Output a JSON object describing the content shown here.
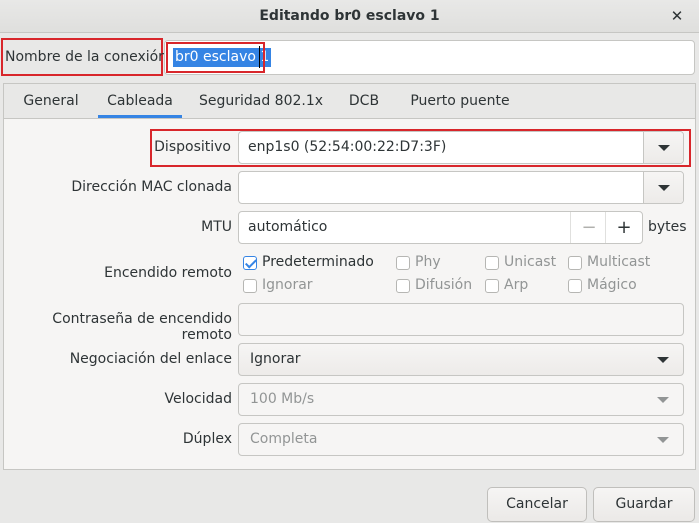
{
  "window": {
    "title": "Editando br0 esclavo 1",
    "close_glyph": "✕"
  },
  "connection": {
    "label": "Nombre de la conexión",
    "value": "br0 esclavo 1"
  },
  "tabs": [
    {
      "label": "General"
    },
    {
      "label": "Cableada"
    },
    {
      "label": "Seguridad 802.1x"
    },
    {
      "label": "DCB"
    },
    {
      "label": "Puerto puente"
    }
  ],
  "active_tab": "Cableada",
  "form": {
    "device": {
      "label": "Dispositivo",
      "value": "enp1s0 (52:54:00:22:D7:3F)"
    },
    "cloned_mac": {
      "label": "Dirección MAC clonada",
      "value": ""
    },
    "mtu": {
      "label": "MTU",
      "value": "automático",
      "minus": "−",
      "plus": "+",
      "unit": "bytes"
    },
    "wake_on_lan": {
      "label": "Encendido remoto",
      "options": [
        {
          "label": "Predeterminado",
          "checked": true,
          "enabled": true
        },
        {
          "label": "Phy",
          "checked": false,
          "enabled": false
        },
        {
          "label": "Unicast",
          "checked": false,
          "enabled": false
        },
        {
          "label": "Multicast",
          "checked": false,
          "enabled": false
        },
        {
          "label": "Ignorar",
          "checked": false,
          "enabled": false
        },
        {
          "label": "Difusión",
          "checked": false,
          "enabled": false
        },
        {
          "label": "Arp",
          "checked": false,
          "enabled": false
        },
        {
          "label": "Mágico",
          "checked": false,
          "enabled": false
        }
      ]
    },
    "wol_password": {
      "label": "Contraseña de encendido remoto",
      "value": ""
    },
    "link_negotiation": {
      "label": "Negociación del enlace",
      "value": "Ignorar"
    },
    "speed": {
      "label": "Velocidad",
      "value": "100 Mb/s"
    },
    "duplex": {
      "label": "Dúplex",
      "value": "Completa"
    }
  },
  "buttons": {
    "cancel": "Cancelar",
    "save": "Guardar"
  },
  "colors": {
    "accent": "#3584e4",
    "highlight_box": "#d8262b"
  }
}
